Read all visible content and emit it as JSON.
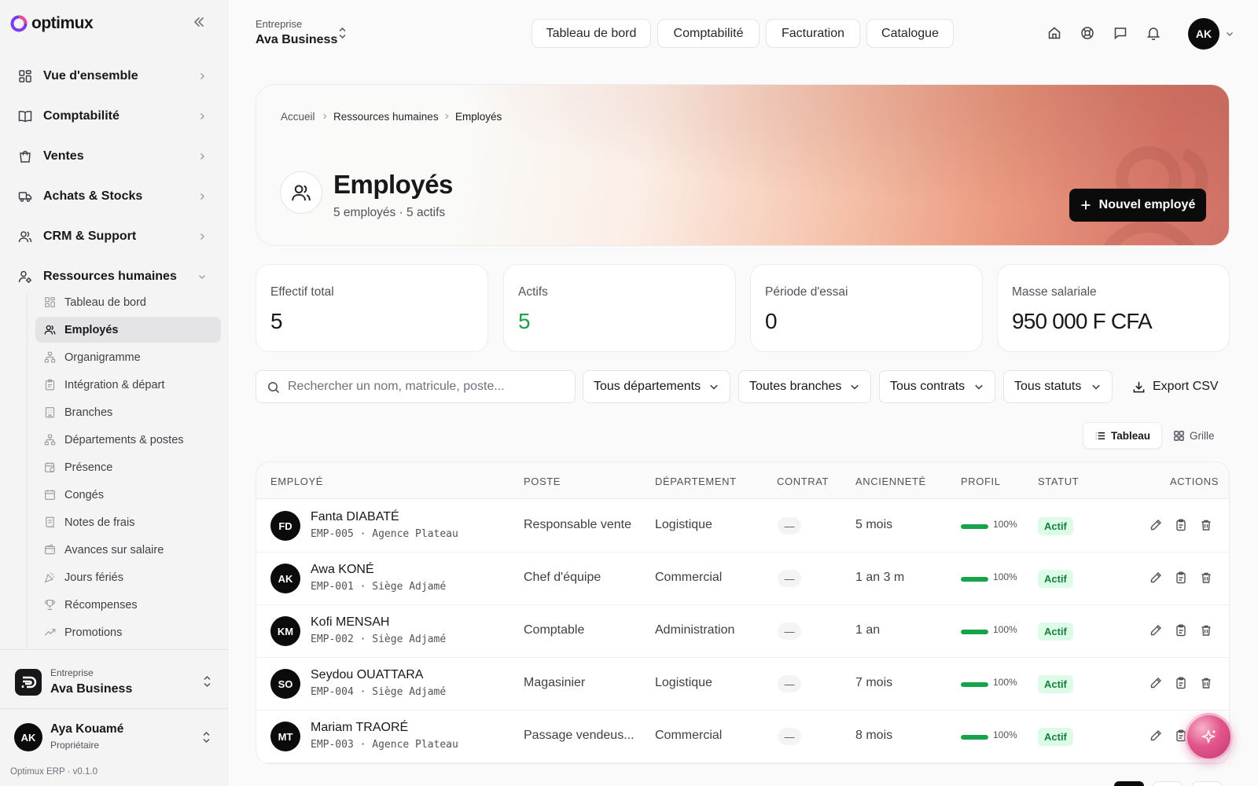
{
  "brand": {
    "name": "optimux",
    "accent": "#7c3aed"
  },
  "sidebar": {
    "items": [
      {
        "label": "Vue d'ensemble",
        "icon": "dashboard-icon"
      },
      {
        "label": "Comptabilité",
        "icon": "book-icon"
      },
      {
        "label": "Ventes",
        "icon": "shopping-bag-icon"
      },
      {
        "label": "Achats & Stocks",
        "icon": "truck-icon"
      },
      {
        "label": "CRM & Support",
        "icon": "users-icon"
      },
      {
        "label": "Ressources humaines",
        "icon": "user-cog-icon",
        "expanded": true
      }
    ],
    "hr_items": [
      {
        "label": "Tableau de bord",
        "icon": "dashboard-icon"
      },
      {
        "label": "Employés",
        "icon": "users-icon",
        "active": true
      },
      {
        "label": "Organigramme",
        "icon": "org-chart-icon"
      },
      {
        "label": "Intégration & départ",
        "icon": "clipboard-icon"
      },
      {
        "label": "Branches",
        "icon": "building-icon"
      },
      {
        "label": "Départements & postes",
        "icon": "org-chart-icon"
      },
      {
        "label": "Présence",
        "icon": "calendar-clock-icon"
      },
      {
        "label": "Congés",
        "icon": "calendar-icon"
      },
      {
        "label": "Notes de frais",
        "icon": "receipt-icon"
      },
      {
        "label": "Avances sur salaire",
        "icon": "wallet-icon"
      },
      {
        "label": "Jours fériés",
        "icon": "party-icon"
      },
      {
        "label": "Récompenses",
        "icon": "trophy-icon"
      },
      {
        "label": "Promotions",
        "icon": "trending-up-icon"
      }
    ],
    "company": {
      "small": "Entreprise",
      "name": "Ava Business"
    },
    "user": {
      "initials": "AK",
      "name": "Aya Kouamé",
      "role": "Propriétaire"
    },
    "version": "Optimux ERP · v0.1.0"
  },
  "topbar": {
    "entreprise_label": "Entreprise",
    "entreprise_name": "Ava Business",
    "tabs": [
      "Tableau de bord",
      "Comptabilité",
      "Facturation",
      "Catalogue"
    ],
    "icons": [
      "home-icon",
      "support-icon",
      "message-icon",
      "bell-icon"
    ],
    "user_initials": "AK"
  },
  "hero": {
    "breadcrumb": [
      "Accueil",
      "Ressources humaines",
      "Employés"
    ],
    "title": "Employés",
    "subtitle": "5 employés · 5 actifs",
    "new_button": "Nouvel employé"
  },
  "stats": [
    {
      "label": "Effectif total",
      "value": "5",
      "color": "#18181b"
    },
    {
      "label": "Actifs",
      "value": "5",
      "color": "#16a34a"
    },
    {
      "label": "Période d'essai",
      "value": "0",
      "color": "#18181b"
    },
    {
      "label": "Masse salariale",
      "value": "950 000 F CFA",
      "color": "#18181b"
    }
  ],
  "filters": {
    "search_placeholder": "Rechercher un nom, matricule, poste...",
    "department": "Tous départements",
    "branch": "Toutes branches",
    "contract": "Tous contrats",
    "status": "Tous statuts",
    "export": "Export CSV"
  },
  "view": {
    "table": "Tableau",
    "grid": "Grille"
  },
  "table": {
    "headers": [
      "EMPLOYÉ",
      "POSTE",
      "DÉPARTEMENT",
      "CONTRAT",
      "ANCIENNETÉ",
      "PROFIL",
      "STATUT",
      "ACTIONS"
    ],
    "rows": [
      {
        "initials": "FD",
        "name": "Fanta DIABATÉ",
        "meta": "EMP-005 · Agence Plateau",
        "poste": "Responsable vente",
        "departement": "Logistique",
        "contrat": "—",
        "anciennete": "5 mois",
        "profil_pct": 100,
        "profil": "100%",
        "statut": "Actif"
      },
      {
        "initials": "AK",
        "name": "Awa KONÉ",
        "meta": "EMP-001 · Siège Adjamé",
        "poste": "Chef d'équipe",
        "departement": "Commercial",
        "contrat": "—",
        "anciennete": "1 an 3 m",
        "profil_pct": 100,
        "profil": "100%",
        "statut": "Actif"
      },
      {
        "initials": "KM",
        "name": "Kofi MENSAH",
        "meta": "EMP-002 · Siège Adjamé",
        "poste": "Comptable",
        "departement": "Administration",
        "contrat": "—",
        "anciennete": "1 an",
        "profil_pct": 100,
        "profil": "100%",
        "statut": "Actif"
      },
      {
        "initials": "SO",
        "name": "Seydou OUATTARA",
        "meta": "EMP-004 · Siège Adjamé",
        "poste": "Magasinier",
        "departement": "Logistique",
        "contrat": "—",
        "anciennete": "7 mois",
        "profil_pct": 100,
        "profil": "100%",
        "statut": "Actif"
      },
      {
        "initials": "MT",
        "name": "Mariam TRAORÉ",
        "meta": "EMP-003 · Agence Plateau",
        "poste": "Passage vendeus...",
        "departement": "Commercial",
        "contrat": "—",
        "anciennete": "8 mois",
        "profil_pct": 100,
        "profil": "100%",
        "statut": "Actif"
      }
    ]
  }
}
